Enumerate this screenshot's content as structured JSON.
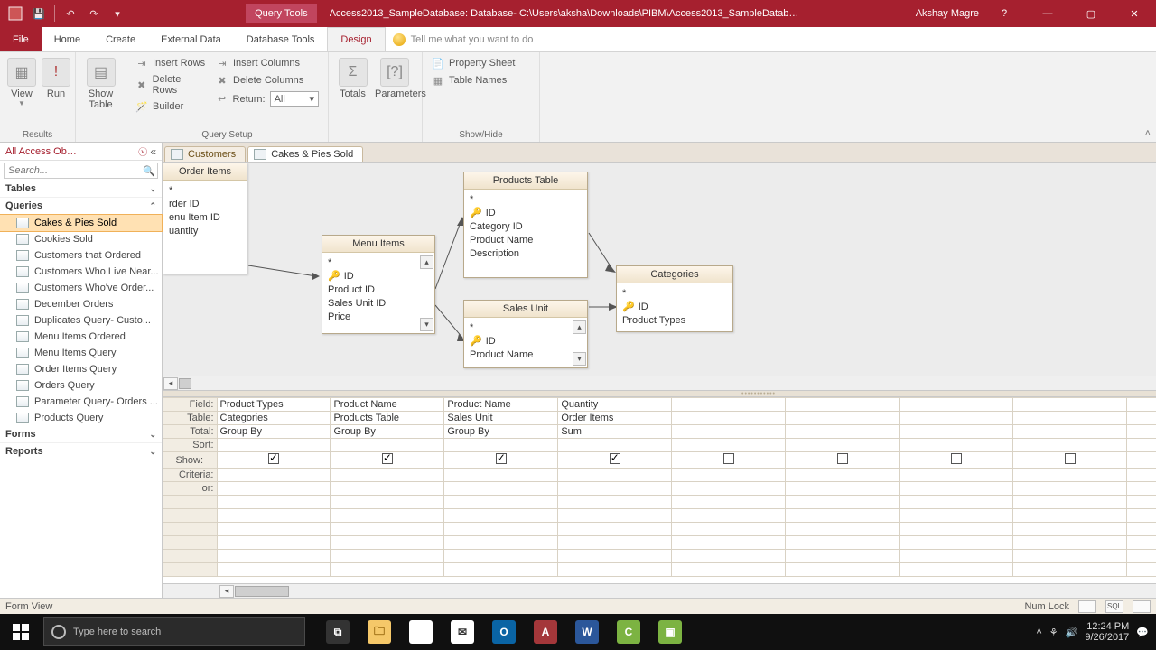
{
  "titlebar": {
    "query_tools": "Query Tools",
    "db_title": "Access2013_SampleDatabase: Database- C:\\Users\\aksha\\Downloads\\PIBM\\Access2013_SampleDatabase.accdb (...",
    "user": "Akshay Magre"
  },
  "ribbon_tabs": {
    "file": "File",
    "home": "Home",
    "create": "Create",
    "external": "External Data",
    "dbtools": "Database Tools",
    "design": "Design",
    "tellme": "Tell me what you want to do"
  },
  "ribbon": {
    "view": "View",
    "run": "Run",
    "show_table": "Show\nTable",
    "insert_rows": "Insert Rows",
    "delete_rows": "Delete Rows",
    "builder": "Builder",
    "insert_cols": "Insert Columns",
    "delete_cols": "Delete Columns",
    "return": "Return:",
    "return_val": "All",
    "totals": "Totals",
    "parameters": "Parameters",
    "prop_sheet": "Property Sheet",
    "table_names": "Table Names",
    "g_results": "Results",
    "g_querysetup": "Query Setup",
    "g_showhide": "Show/Hide"
  },
  "nav": {
    "header": "All Access Ob…",
    "search_ph": "Search...",
    "sec_tables": "Tables",
    "sec_queries": "Queries",
    "sec_forms": "Forms",
    "sec_reports": "Reports",
    "queries": [
      "Cakes & Pies Sold",
      "Cookies Sold",
      "Customers that Ordered",
      "Customers Who Live Near...",
      "Customers Who've Order...",
      "December Orders",
      "Duplicates Query- Custo...",
      "Menu Items Ordered",
      "Menu Items Query",
      "Order Items Query",
      "Orders Query",
      "Parameter Query- Orders ...",
      "Products Query"
    ]
  },
  "doc_tabs": {
    "t1": "Customers",
    "t2": "Cakes & Pies Sold"
  },
  "tables": {
    "order_items": {
      "title": "Order Items",
      "rows": [
        "*",
        "rder ID",
        "enu Item ID",
        "uantity"
      ]
    },
    "menu_items": {
      "title": "Menu Items",
      "rows": [
        "*",
        "ID",
        "Product ID",
        "Sales Unit ID",
        "Price"
      ]
    },
    "products": {
      "title": "Products Table",
      "rows": [
        "*",
        "ID",
        "Category ID",
        "Product Name",
        "Description"
      ]
    },
    "sales_unit": {
      "title": "Sales Unit",
      "rows": [
        "*",
        "ID",
        "Product Name"
      ]
    },
    "categories": {
      "title": "Categories",
      "rows": [
        "*",
        "ID",
        "Product Types"
      ]
    }
  },
  "qbe": {
    "labels": {
      "field": "Field:",
      "table": "Table:",
      "total": "Total:",
      "sort": "Sort:",
      "show": "Show:",
      "criteria": "Criteria:",
      "or": "or:"
    },
    "cols": [
      {
        "field": "Product Types",
        "table": "Categories",
        "total": "Group By",
        "show": true
      },
      {
        "field": "Product Name",
        "table": "Products Table",
        "total": "Group By",
        "show": true
      },
      {
        "field": "Product Name",
        "table": "Sales Unit",
        "total": "Group By",
        "show": true
      },
      {
        "field": "Quantity",
        "table": "Order Items",
        "total": "Sum",
        "show": true
      },
      {
        "field": "",
        "table": "",
        "total": "",
        "show": false
      },
      {
        "field": "",
        "table": "",
        "total": "",
        "show": false
      },
      {
        "field": "",
        "table": "",
        "total": "",
        "show": false
      },
      {
        "field": "",
        "table": "",
        "total": "",
        "show": false
      },
      {
        "field": "",
        "table": "",
        "total": "",
        "show": false
      },
      {
        "field": "",
        "table": "",
        "total": "",
        "show": false
      }
    ]
  },
  "status": {
    "left": "Form View",
    "numlock": "Num Lock",
    "sql": "SQL"
  },
  "taskbar": {
    "search_ph": "Type here to search",
    "time": "12:24 PM",
    "date": "9/26/2017"
  }
}
